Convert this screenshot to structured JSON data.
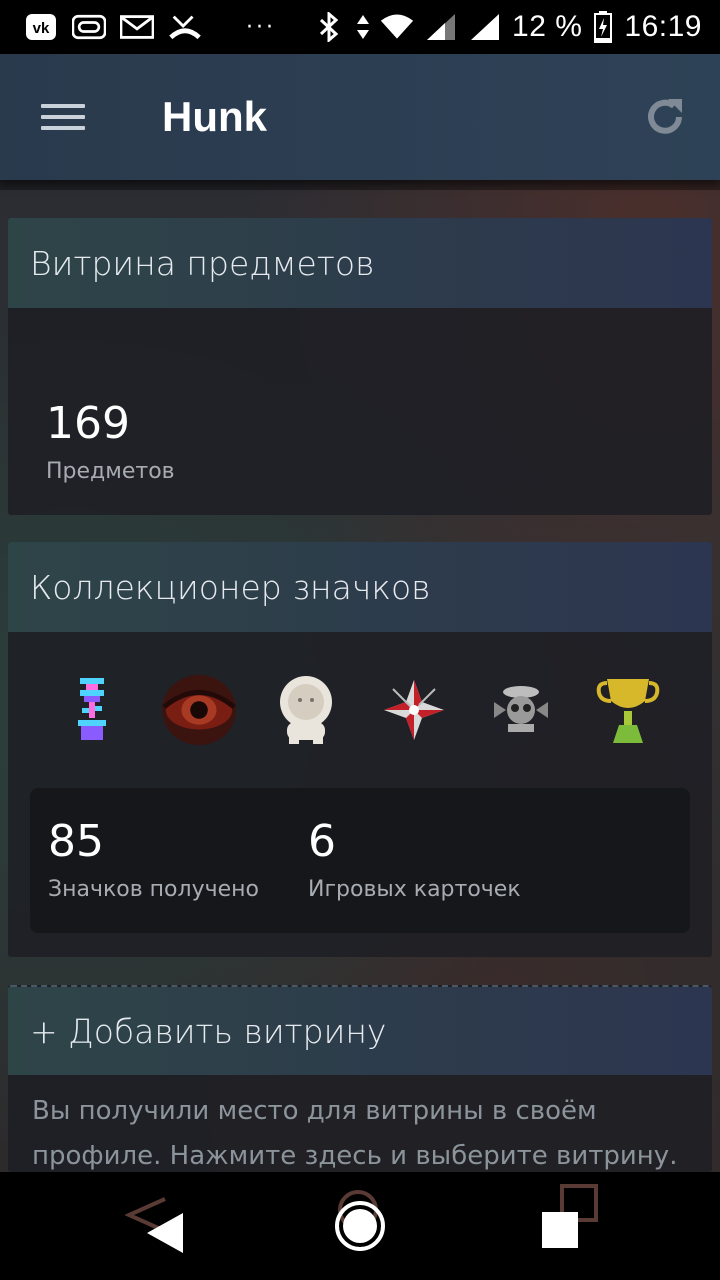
{
  "status_bar": {
    "battery_percent": "12 %",
    "time": "16:19",
    "icons": [
      "vk-icon",
      "voicemail-icon",
      "mail-icon",
      "missed-call-icon",
      "more-notifications-icon",
      "bluetooth-icon",
      "data-activity-icon",
      "wifi-icon",
      "signal-icon",
      "signal-icon",
      "battery-charging-icon"
    ]
  },
  "app_bar": {
    "title": "Hunk"
  },
  "items_showcase": {
    "title": "Витрина предметов",
    "count": "169",
    "count_label": "Предметов"
  },
  "badge_collector": {
    "title": "Коллекционер значков",
    "badges": [
      "flower-pot-badge",
      "red-eye-badge",
      "astronaut-badge",
      "umbrella-badge",
      "skull-badge",
      "trophy-badge"
    ],
    "stats": [
      {
        "value": "85",
        "label": "Значков получено"
      },
      {
        "value": "6",
        "label": "Игровых карточек"
      }
    ]
  },
  "add_showcase": {
    "title": "+ Добавить витрину",
    "description_line1": "Вы получили место для витрины в своём",
    "description_line2": "профиле. Нажмите здесь и выберите витрину."
  },
  "colors": {
    "app_bar": "#2e4257",
    "accent_header": "#2d3b4c",
    "muted_text": "#a7acb3"
  }
}
